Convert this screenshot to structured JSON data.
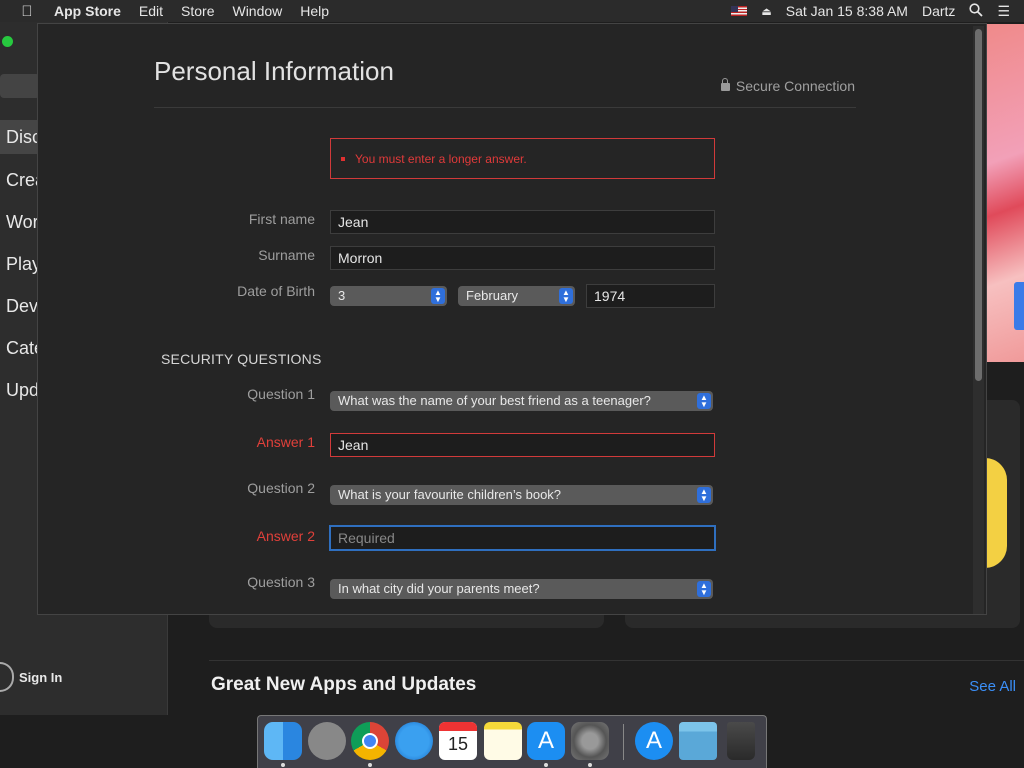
{
  "menubar": {
    "app": "App Store",
    "items": [
      "Edit",
      "Store",
      "Window",
      "Help"
    ],
    "clock": "Sat Jan 15  8:38 AM",
    "user": "Dartz"
  },
  "background": {
    "sidebar_items": [
      "Disc",
      "Crea",
      "Wor",
      "Play",
      "Dev",
      "Cate",
      "Upd"
    ],
    "sign_in": "Sign In",
    "section_title": "Great New Apps and Updates",
    "see_all": "See All"
  },
  "dialog": {
    "title": "Personal Information",
    "secure": "Secure Connection",
    "error": "You must enter a longer answer.",
    "first_name_label": "First name",
    "first_name": "Jean",
    "surname_label": "Surname",
    "surname": "Morron",
    "dob_label": "Date of Birth",
    "dob_day": "3",
    "dob_month": "February",
    "dob_year": "1974",
    "security_heading": "SECURITY QUESTIONS",
    "q1_label": "Question 1",
    "q1": "What was the name of your best friend as a teenager?",
    "a1_label": "Answer 1",
    "a1": "Jean",
    "q2_label": "Question 2",
    "q2": "What is your favourite children’s book?",
    "a2_label": "Answer 2",
    "a2_placeholder": "Required",
    "q3_label": "Question 3",
    "q3": "In what city did your parents meet?"
  },
  "dock": {
    "calendar_day": "15",
    "apps": [
      "Finder",
      "Launchpad",
      "Google Chrome",
      "Safari",
      "Calendar",
      "Notes",
      "App Store",
      "System Preferences",
      "App Store",
      "Downloads",
      "Trash"
    ]
  },
  "colors": {
    "error": "#e03a3a",
    "accent": "#2f6fdb",
    "dialog_bg": "#252525"
  }
}
